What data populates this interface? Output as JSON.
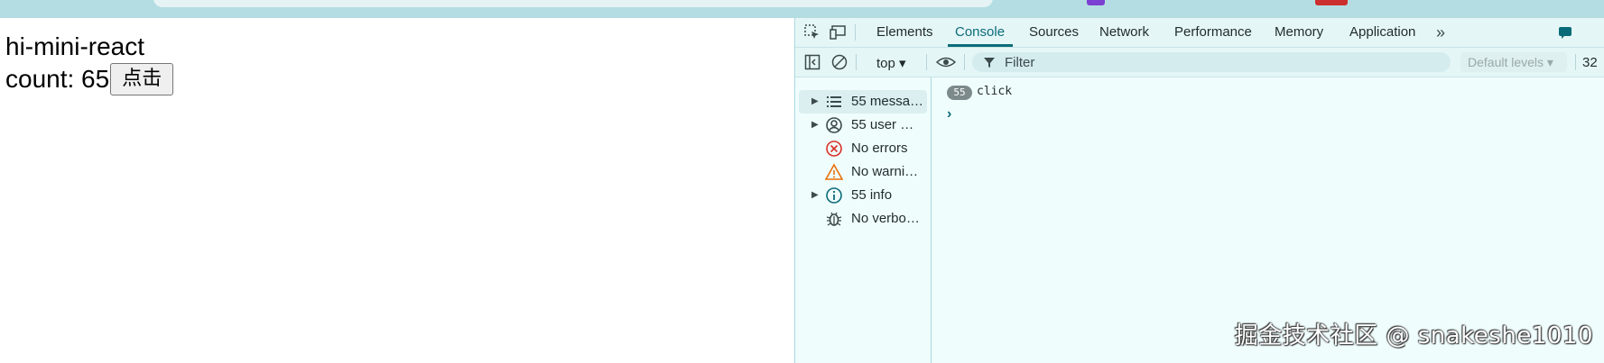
{
  "page": {
    "title": "hi-mini-react",
    "count_label": "count: 65",
    "button_label": "点击"
  },
  "devtools": {
    "tabs": [
      "Elements",
      "Console",
      "Sources",
      "Network",
      "Performance",
      "Memory",
      "Application"
    ],
    "active_tab": "Console",
    "more_tabs": "»",
    "context": "top ▾",
    "filter_placeholder": "Filter",
    "levels": "Default levels ▾",
    "issues_count": "32",
    "sidebar": [
      {
        "label": "55 messa…",
        "icon": "list-icon",
        "expandable": true
      },
      {
        "label": "55 user …",
        "icon": "user-icon",
        "expandable": true
      },
      {
        "label": "No errors",
        "icon": "error-icon",
        "expandable": false
      },
      {
        "label": "No warni…",
        "icon": "warning-icon",
        "expandable": false
      },
      {
        "label": "55 info",
        "icon": "info-icon",
        "expandable": true
      },
      {
        "label": "No verbo…",
        "icon": "bug-icon",
        "expandable": false
      }
    ],
    "console": {
      "repeat_count": "55",
      "message": "click",
      "prompt": "›"
    }
  },
  "watermark": "掘金技术社区 @ snakeshe1010",
  "colors": {
    "accent": "#0a6b78",
    "devtools_bg": "#f0fdfd",
    "error": "#d93025",
    "warning": "#e8710a",
    "info": "#0a6b78"
  }
}
